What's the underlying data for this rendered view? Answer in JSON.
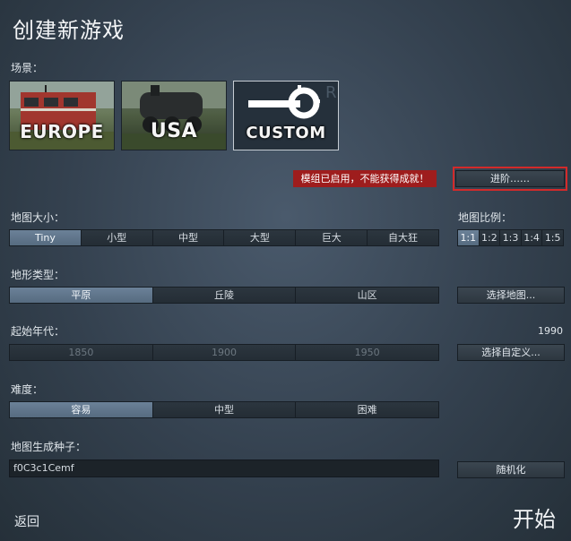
{
  "title": "创建新游戏",
  "scenario": {
    "label": "场景：",
    "items": [
      {
        "name": "EUROPE"
      },
      {
        "name": "USA"
      },
      {
        "name": "CUSTOM"
      }
    ]
  },
  "warning": "模组已启用，不能获得成就！",
  "advanced_button": "进阶……",
  "map_size": {
    "label": "地图大小：",
    "options": [
      "Tiny",
      "小型",
      "中型",
      "大型",
      "巨大",
      "自大狂"
    ],
    "selected": "Tiny"
  },
  "map_ratio": {
    "label": "地图比例：",
    "options": [
      "1:1",
      "1:2",
      "1:3",
      "1:4",
      "1:5"
    ],
    "selected": "1:1"
  },
  "terrain": {
    "label": "地形类型：",
    "options": [
      "平原",
      "丘陵",
      "山区"
    ],
    "selected": "平原"
  },
  "select_map_button": "选择地图...",
  "start_year": {
    "label": "起始年代：",
    "value": "1990",
    "options": [
      "1850",
      "1900",
      "1950"
    ]
  },
  "select_custom_button": "选择自定义...",
  "difficulty": {
    "label": "难度：",
    "options": [
      "容易",
      "中型",
      "困难"
    ],
    "selected": "容易"
  },
  "seed": {
    "label": "地图生成种子：",
    "value": "f0C3c1Cemf"
  },
  "randomize_button": "随机化",
  "back_button": "返回",
  "start_button": "开始",
  "colors": {
    "selected": "#6b8198",
    "warning": "#9e1d1d",
    "highlight_outline": "#d32a2a"
  }
}
